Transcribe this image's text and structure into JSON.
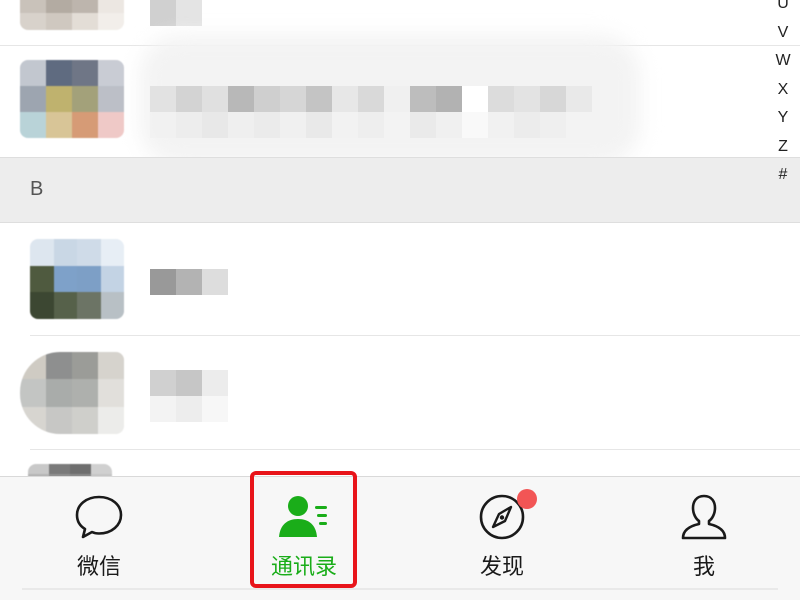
{
  "index_letters": [
    "U",
    "V",
    "W",
    "X",
    "Y",
    "Z",
    "#"
  ],
  "section": {
    "letter": "B"
  },
  "tabs": [
    {
      "label": "微信",
      "icon": "chat-bubble-icon",
      "active": false
    },
    {
      "label": "通讯录",
      "icon": "contacts-icon",
      "active": true
    },
    {
      "label": "发现",
      "icon": "compass-icon",
      "active": false,
      "badge": true
    },
    {
      "label": "我",
      "icon": "person-icon",
      "active": false
    }
  ],
  "colors": {
    "active_tab": "#1aad19",
    "highlight_box": "#e8141a",
    "badge": "#f25555"
  }
}
